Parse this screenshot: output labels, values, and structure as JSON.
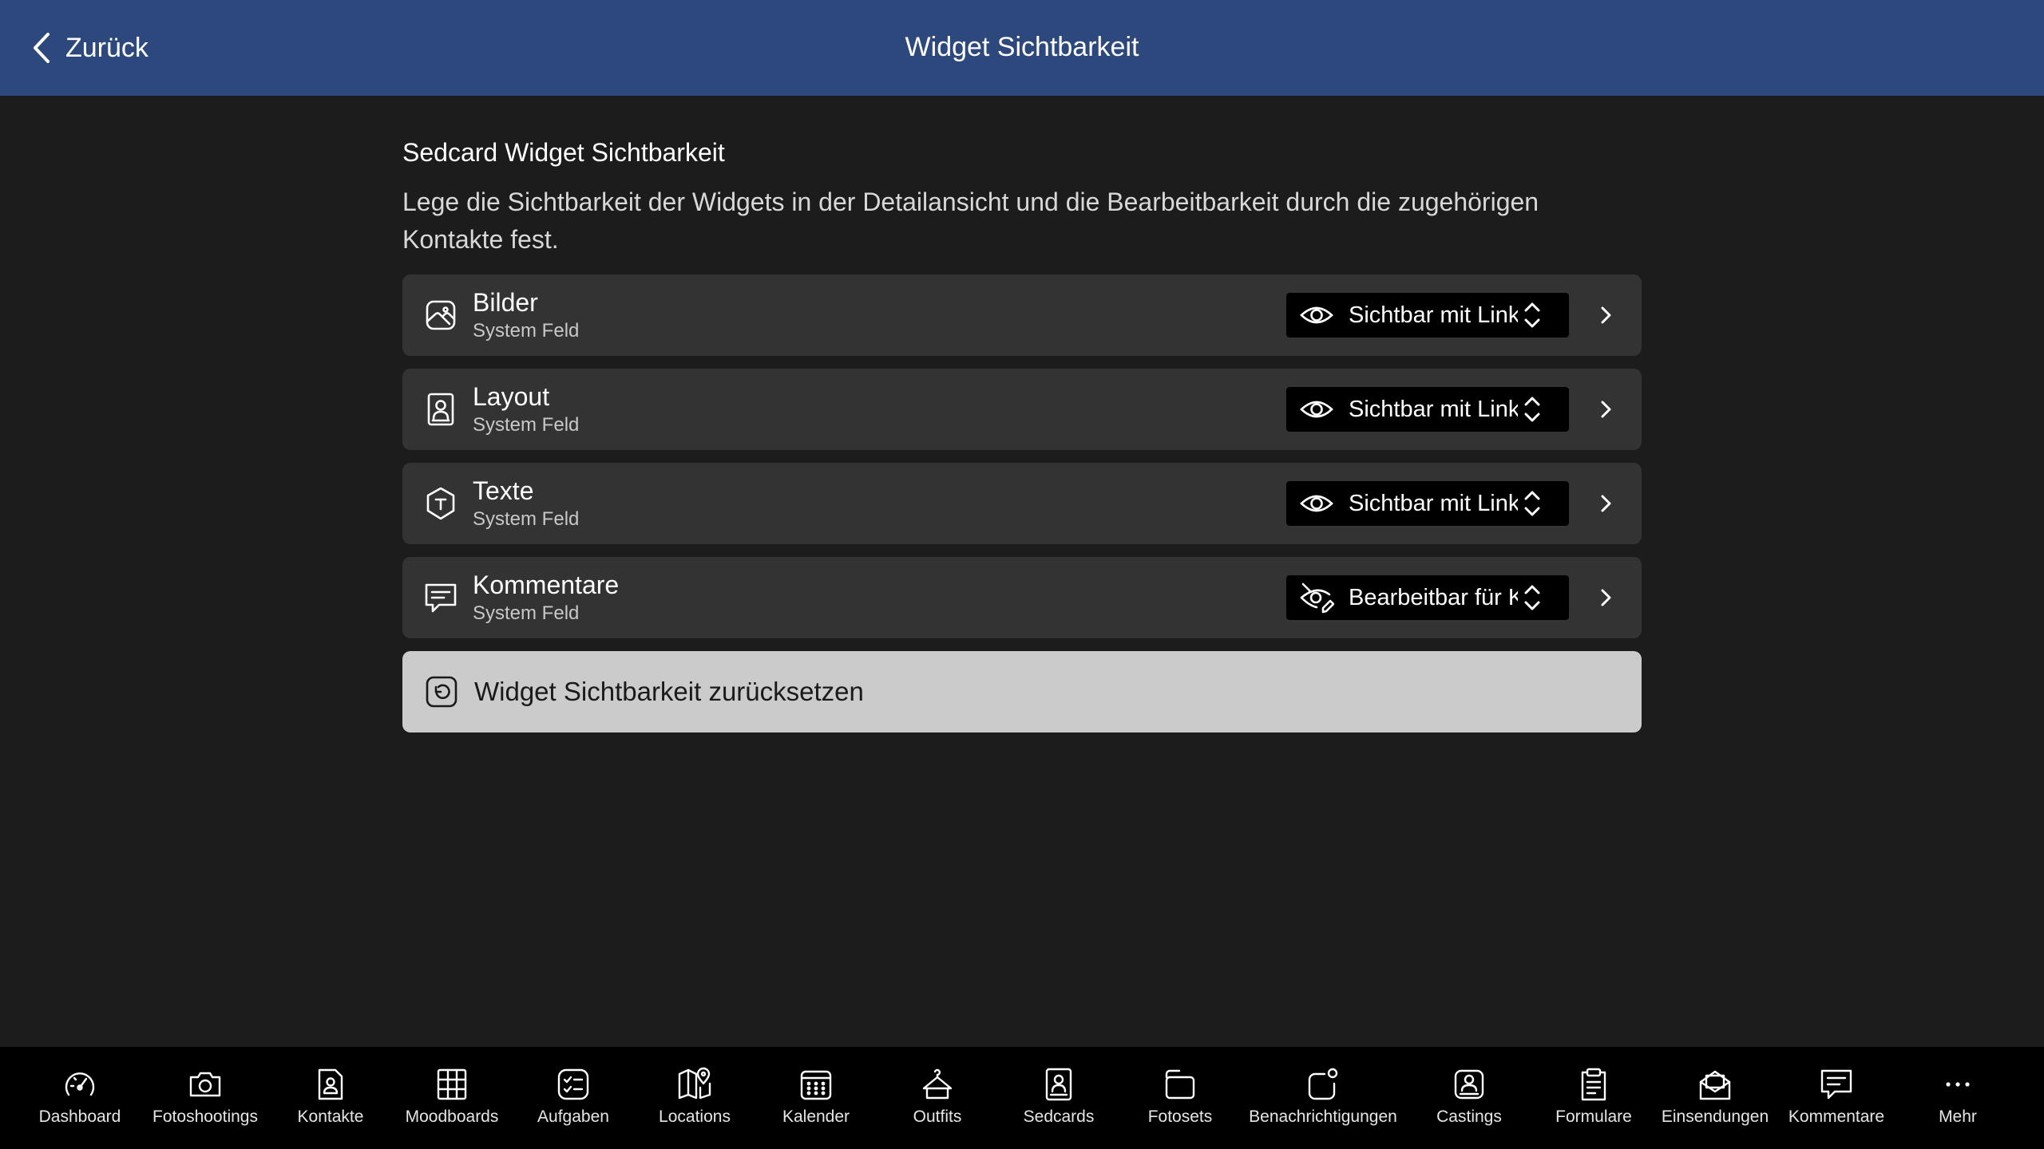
{
  "header": {
    "back_label": "Zurück",
    "title": "Widget Sichtbarkeit",
    "background_color": "#2d487c"
  },
  "section": {
    "title": "Sedcard Widget Sichtbarkeit",
    "description": "Lege die Sichtbarkeit der Widgets in der Detailansicht und die Bearbeitbarkeit durch die zugehörigen Kontakte fest."
  },
  "widgets": [
    {
      "icon": "image-icon",
      "title": "Bilder",
      "subtitle": "System Feld",
      "visibility_icon": "eye-icon",
      "visibility": "Sichtbar mit Link"
    },
    {
      "icon": "portrait-icon",
      "title": "Layout",
      "subtitle": "System Feld",
      "visibility_icon": "eye-icon",
      "visibility": "Sichtbar mit Link"
    },
    {
      "icon": "text-hexagon-icon",
      "title": "Texte",
      "subtitle": "System Feld",
      "visibility_icon": "eye-icon",
      "visibility": "Sichtbar mit Link"
    },
    {
      "icon": "comment-icon",
      "title": "Kommentare",
      "subtitle": "System Feld",
      "visibility_icon": "eye-edit-icon",
      "visibility": "Bearbeitbar für K"
    }
  ],
  "reset": {
    "icon": "reset-icon",
    "label": "Widget Sichtbarkeit zurücksetzen"
  },
  "tabbar": {
    "items": [
      {
        "label": "Dashboard",
        "icon": "speedometer-icon"
      },
      {
        "label": "Fotoshootings",
        "icon": "camera-icon"
      },
      {
        "label": "Kontakte",
        "icon": "contact-icon"
      },
      {
        "label": "Moodboards",
        "icon": "moodboard-grid-icon"
      },
      {
        "label": "Aufgaben",
        "icon": "checklist-icon"
      },
      {
        "label": "Locations",
        "icon": "map-pin-icon"
      },
      {
        "label": "Kalender",
        "icon": "calendar-icon"
      },
      {
        "label": "Outfits",
        "icon": "shirt-icon"
      },
      {
        "label": "Sedcards",
        "icon": "sedcard-icon"
      },
      {
        "label": "Fotosets",
        "icon": "photo-stack-icon"
      },
      {
        "label": "Benachrichtigungen",
        "icon": "bell-badge-icon"
      },
      {
        "label": "Castings",
        "icon": "casting-icon"
      },
      {
        "label": "Formulare",
        "icon": "clipboard-icon"
      },
      {
        "label": "Einsendungen",
        "icon": "envelope-icon"
      },
      {
        "label": "Kommentare",
        "icon": "comment-icon"
      },
      {
        "label": "Mehr",
        "icon": "more-dots-icon"
      }
    ]
  }
}
